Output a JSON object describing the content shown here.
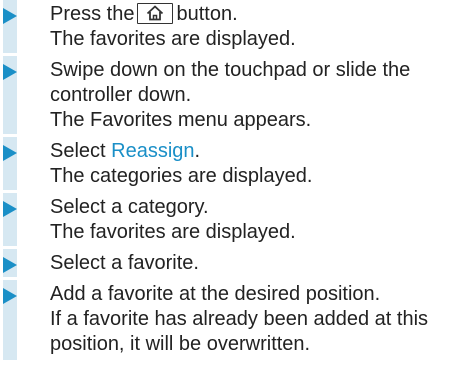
{
  "colors": {
    "accent": "#1a8fc7",
    "bar": "#d6e8f2",
    "text": "#222222"
  },
  "steps": [
    {
      "action_before": "Press the",
      "key_icon": "home-icon",
      "action_after": "button.",
      "result": "The favorites are displayed."
    },
    {
      "action_line1": "Swipe down on the touchpad or slide the",
      "action_line2": "controller down.",
      "result": "The Favorites menu appears."
    },
    {
      "action_before": "Select",
      "action_link": "Reassign",
      "action_after": ".",
      "result": "The categories are displayed."
    },
    {
      "action": "Select a category.",
      "result": "The favorites are displayed."
    },
    {
      "action": "Select a favorite."
    },
    {
      "action": "Add a favorite at the desired position.",
      "result_line1": "If a favorite has already been added at this",
      "result_line2": "position, it will be overwritten."
    }
  ]
}
